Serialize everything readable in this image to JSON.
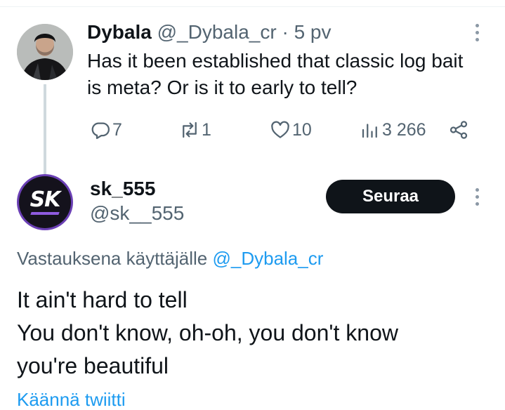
{
  "tweet": {
    "author_name": "Dybala",
    "author_handle": "@_Dybala_cr",
    "separator": "·",
    "time": "5 pv",
    "text": "Has it been established that classic log bait is meta? Or is it to early to tell?",
    "replies": "7",
    "retweets": "1",
    "likes": "10",
    "views": "3 266"
  },
  "reply": {
    "author_name": "sk_555",
    "author_handle": "@sk__555",
    "avatar_text": "SK",
    "follow_label": "Seuraa",
    "replying_prefix": "Vastauksena käyttäjälle",
    "replying_to": "@_Dybala_cr",
    "text_lines": [
      "It ain't hard to tell",
      "You don't know, oh-oh, you don't know",
      "you're beautiful"
    ],
    "translate_label": "Käännä twiitti"
  },
  "icons": {
    "reply": "reply-icon",
    "retweet": "retweet-icon",
    "like": "heart-icon",
    "views": "views-icon",
    "share": "share-icon",
    "more": "more-icon"
  },
  "colors": {
    "accent": "#1d9bf0",
    "text": "#0f1419",
    "muted": "#536471",
    "thread_line": "#cfd9de",
    "follow_button": "#0f1419",
    "avatar_ring": "#6b40b5"
  }
}
